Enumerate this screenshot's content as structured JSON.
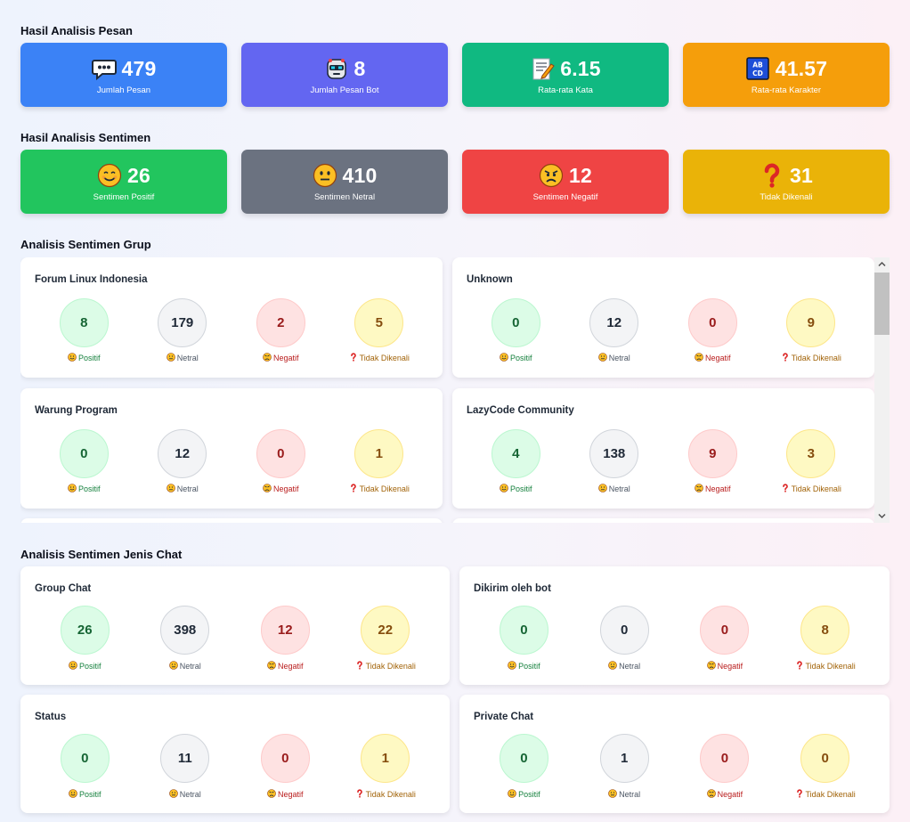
{
  "sections": {
    "pesan": "Hasil Analisis Pesan",
    "sentimen": "Hasil Analisis Sentimen",
    "grup": "Analisis Sentimen Grup",
    "jenis_chat": "Analisis Sentimen Jenis Chat"
  },
  "message_stats": [
    {
      "value": "479",
      "label": "Jumlah Pesan",
      "icon": "speech-bubble-icon",
      "color": "#3b82f6"
    },
    {
      "value": "8",
      "label": "Jumlah Pesan Bot",
      "icon": "robot-icon",
      "color": "#6366f1"
    },
    {
      "value": "6.15",
      "label": "Rata-rata Kata",
      "icon": "memo-icon",
      "color": "#10b981"
    },
    {
      "value": "41.57",
      "label": "Rata-rata Karakter",
      "icon": "abcd-icon",
      "color": "#f59e0b"
    }
  ],
  "sentiment_stats": [
    {
      "value": "26",
      "label": "Sentimen Positif",
      "icon": "smile-icon",
      "color": "#22c55e"
    },
    {
      "value": "410",
      "label": "Sentimen Netral",
      "icon": "neutral-face-icon",
      "color": "#6b7280"
    },
    {
      "value": "12",
      "label": "Sentimen Negatif",
      "icon": "angry-face-icon",
      "color": "#ef4444"
    },
    {
      "value": "31",
      "label": "Tidak Dikenali",
      "icon": "question-icon",
      "color": "#eab308"
    }
  ],
  "labels": {
    "positif": "Positif",
    "netral": "Netral",
    "negatif": "Negatif",
    "tidak_dikenali": "Tidak Dikenali"
  },
  "groups": [
    {
      "name": "Forum Linux Indonesia",
      "positif": "8",
      "netral": "179",
      "negatif": "2",
      "tidak_dikenali": "5"
    },
    {
      "name": "Unknown",
      "positif": "0",
      "netral": "12",
      "negatif": "0",
      "tidak_dikenali": "9"
    },
    {
      "name": "Warung Program",
      "positif": "0",
      "netral": "12",
      "negatif": "0",
      "tidak_dikenali": "1"
    },
    {
      "name": "LazyCode Community",
      "positif": "4",
      "netral": "138",
      "negatif": "9",
      "tidak_dikenali": "3"
    }
  ],
  "chat_types": [
    {
      "name": "Group Chat",
      "positif": "26",
      "netral": "398",
      "negatif": "12",
      "tidak_dikenali": "22"
    },
    {
      "name": "Dikirim oleh bot",
      "positif": "0",
      "netral": "0",
      "negatif": "0",
      "tidak_dikenali": "8"
    },
    {
      "name": "Status",
      "positif": "0",
      "netral": "11",
      "negatif": "0",
      "tidak_dikenali": "1"
    },
    {
      "name": "Private Chat",
      "positif": "0",
      "netral": "1",
      "negatif": "0",
      "tidak_dikenali": "0"
    }
  ]
}
